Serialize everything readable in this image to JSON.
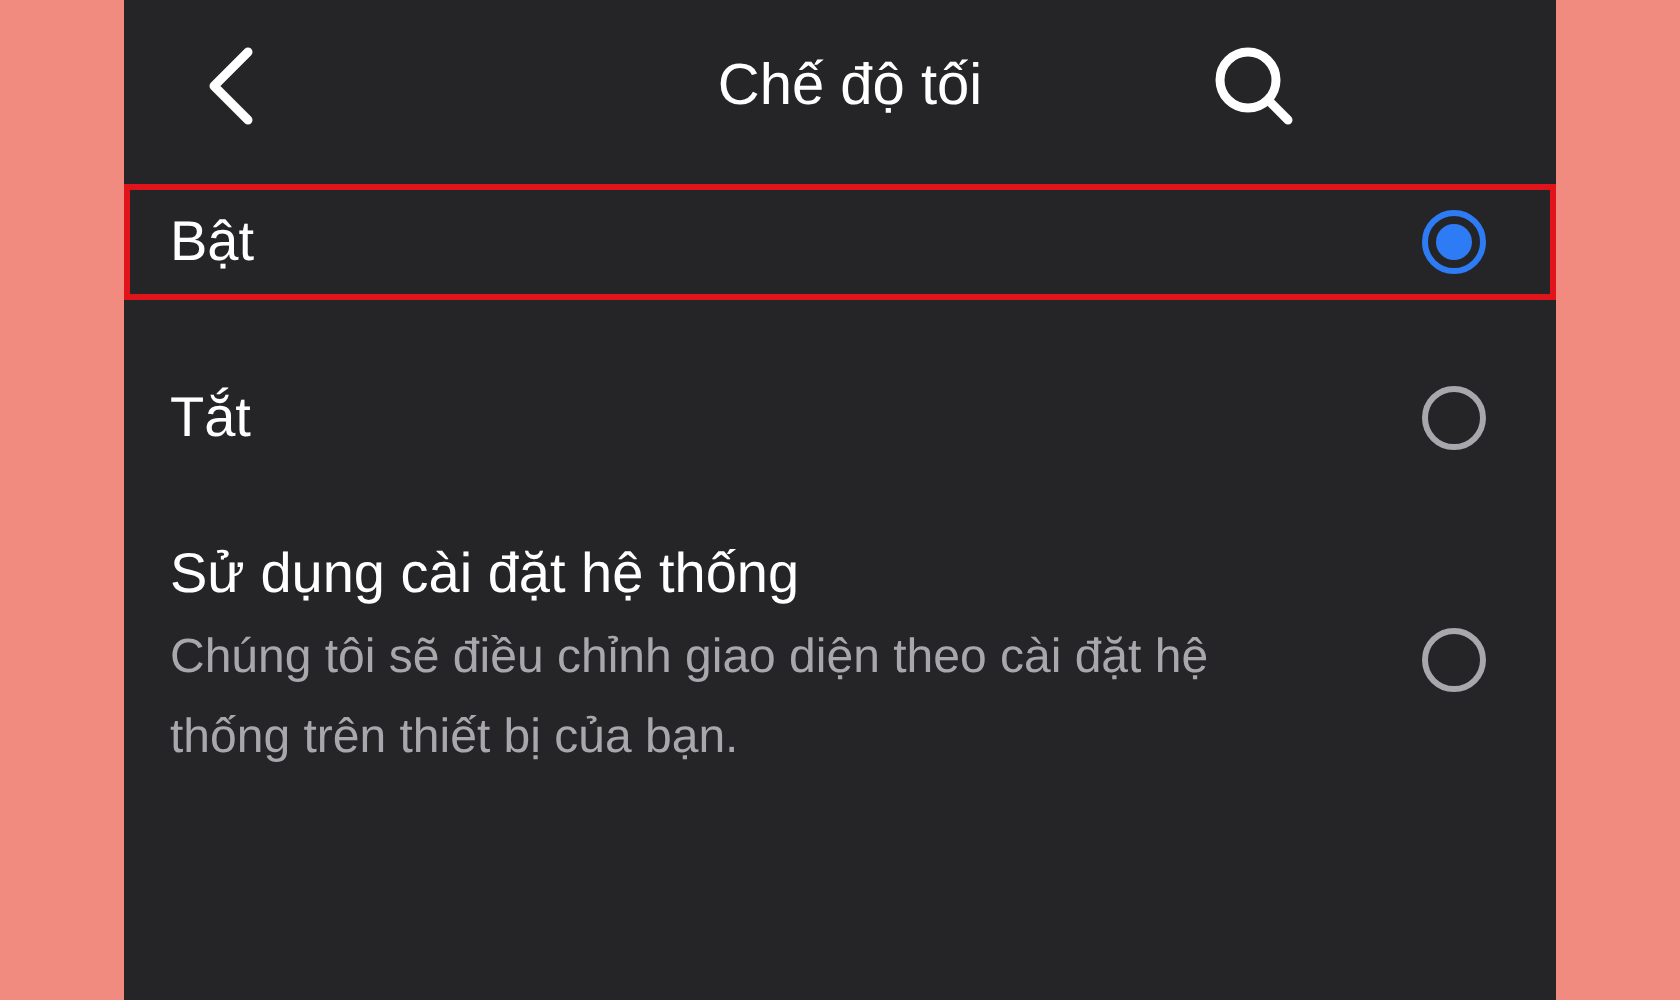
{
  "header": {
    "title": "Chế độ tối"
  },
  "options": [
    {
      "label": "Bật",
      "selected": true,
      "highlighted": true
    },
    {
      "label": "Tắt",
      "selected": false,
      "highlighted": false
    },
    {
      "label": "Sử dụng cài đặt hệ thống",
      "description": "Chúng tôi sẽ điều chỉnh giao diện theo cài đặt hệ thống trên thiết bị của bạn.",
      "selected": false,
      "highlighted": false
    }
  ]
}
